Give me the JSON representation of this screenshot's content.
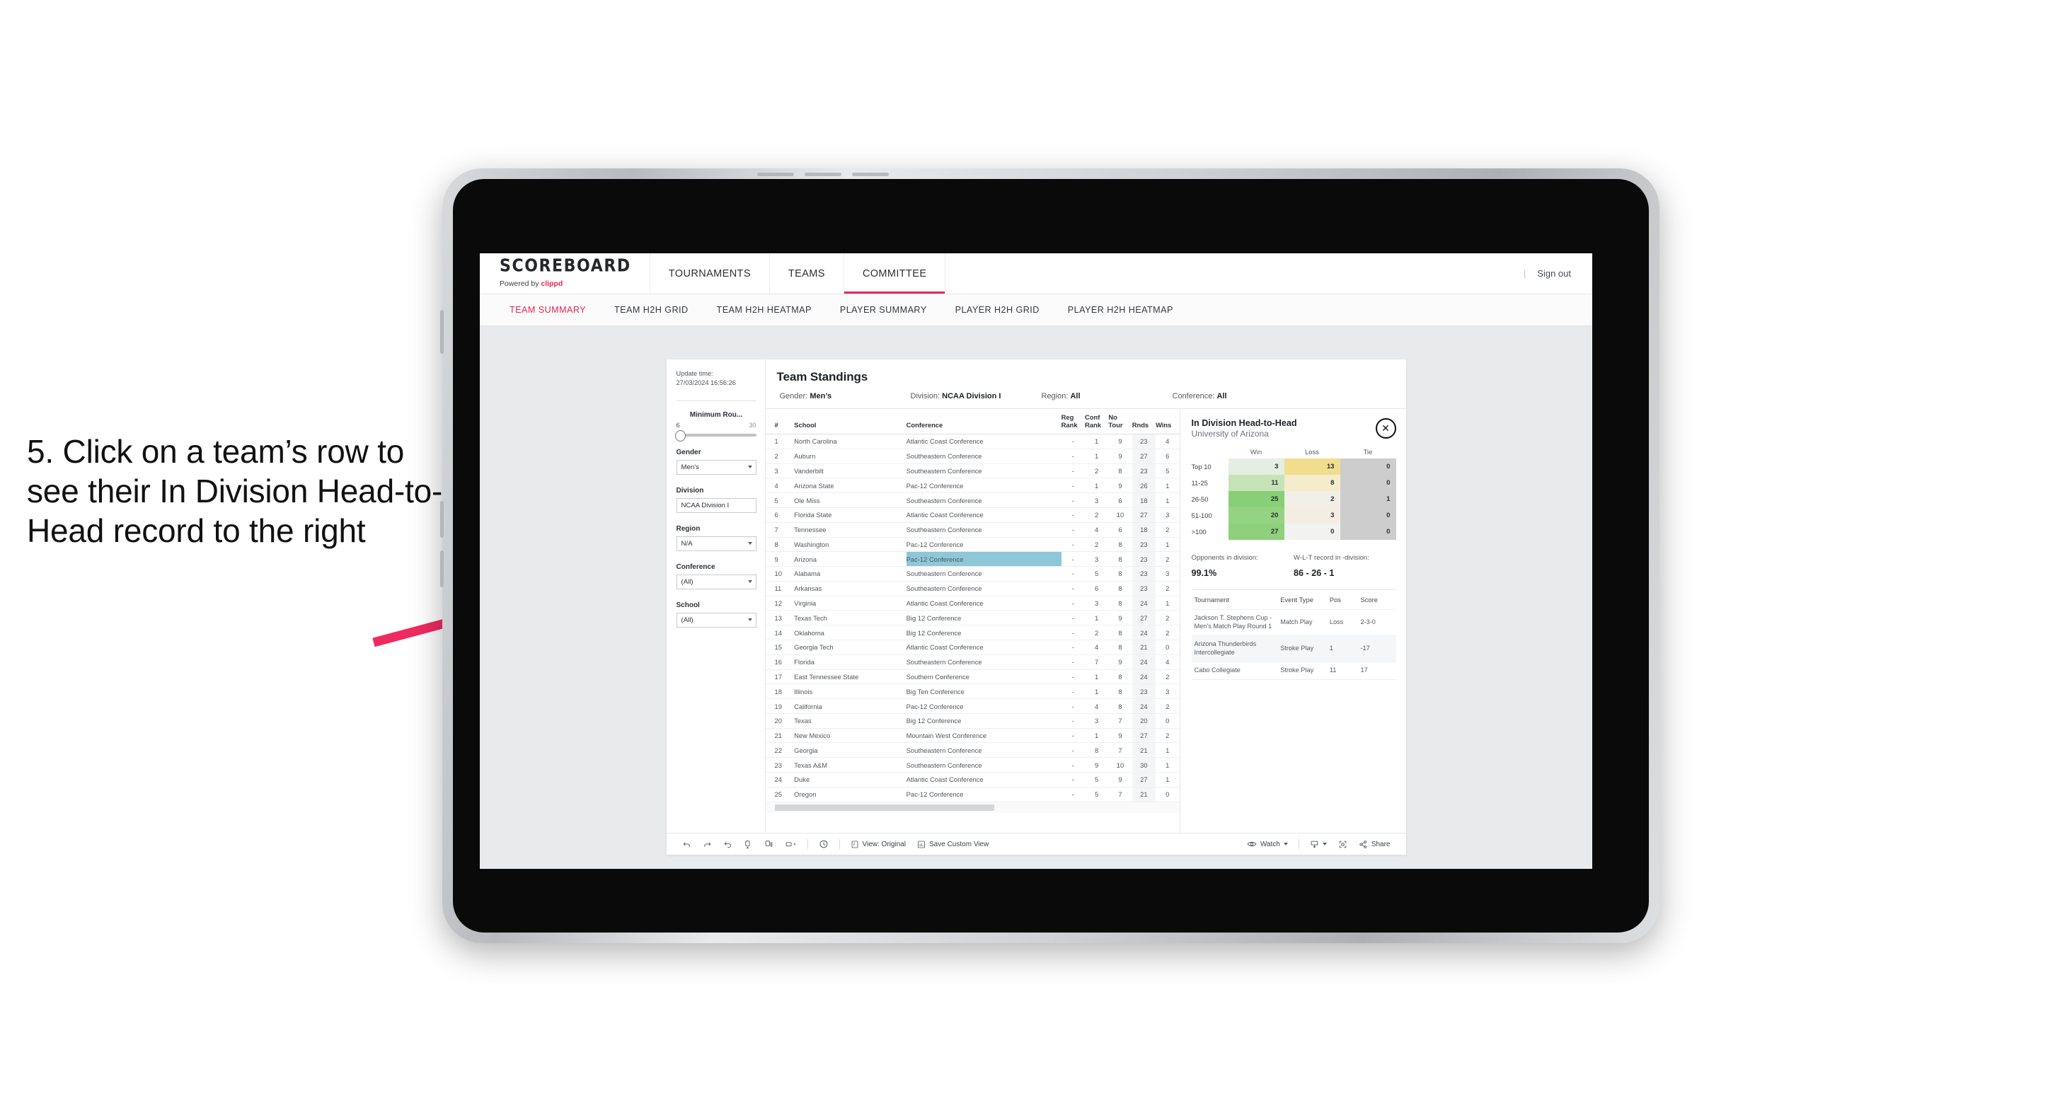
{
  "annotation": {
    "text": "5. Click on a team’s row to see their In Division Head-to-Head record to the right",
    "arrow_color": "#ef2a61"
  },
  "app": {
    "brand": {
      "title": "SCOREBOARD",
      "powered_prefix": "Powered by ",
      "powered_name": "clippd"
    },
    "top_nav": [
      {
        "label": "TOURNAMENTS",
        "active": false
      },
      {
        "label": "TEAMS",
        "active": false
      },
      {
        "label": "COMMITTEE",
        "active": true
      }
    ],
    "top_right": {
      "separator": "|",
      "sign_out": "Sign out"
    },
    "sub_nav": [
      {
        "label": "TEAM SUMMARY",
        "active": true
      },
      {
        "label": "TEAM H2H GRID",
        "active": false
      },
      {
        "label": "TEAM H2H HEATMAP",
        "active": false
      },
      {
        "label": "PLAYER SUMMARY",
        "active": false
      },
      {
        "label": "PLAYER H2H GRID",
        "active": false
      },
      {
        "label": "PLAYER H2H HEATMAP",
        "active": false
      }
    ],
    "accent_color": "#e8264f"
  },
  "filters": {
    "update_time_label": "Update time:",
    "update_time_value": "27/03/2024 16:56:26",
    "slider": {
      "title": "Minimum Rou...",
      "min": "6",
      "max": "30",
      "value": 6
    },
    "groups": [
      {
        "label": "Gender",
        "value": "Men’s"
      },
      {
        "label": "Division",
        "value": "NCAA Division I"
      },
      {
        "label": "Region",
        "value": "N/A"
      },
      {
        "label": "Conference",
        "value": "(All)"
      },
      {
        "label": "School",
        "value": "(All)"
      }
    ]
  },
  "standings": {
    "title": "Team Standings",
    "filter_strip": [
      {
        "key": "Gender: ",
        "value": "Men’s"
      },
      {
        "key": "Division: ",
        "value": "NCAA Division I"
      },
      {
        "key": "Region: ",
        "value": "All"
      },
      {
        "key": "Conference: ",
        "value": "All"
      }
    ],
    "columns": [
      "#",
      "School",
      "Conference",
      "Reg Rank",
      "Conf Rank",
      "No Tour",
      "Rnds",
      "Wins"
    ],
    "rows": [
      {
        "rank": "1",
        "school": "North Carolina",
        "conference": "Atlantic Coast Conference",
        "reg": "-",
        "conf": "1",
        "notour": "9",
        "rnds": "23",
        "wins": "4",
        "selected": false
      },
      {
        "rank": "2",
        "school": "Auburn",
        "conference": "Southeastern Conference",
        "reg": "-",
        "conf": "1",
        "notour": "9",
        "rnds": "27",
        "wins": "6",
        "selected": false
      },
      {
        "rank": "3",
        "school": "Vanderbilt",
        "conference": "Southeastern Conference",
        "reg": "-",
        "conf": "2",
        "notour": "8",
        "rnds": "23",
        "wins": "5",
        "selected": false
      },
      {
        "rank": "4",
        "school": "Arizona State",
        "conference": "Pac-12 Conference",
        "reg": "-",
        "conf": "1",
        "notour": "9",
        "rnds": "26",
        "wins": "1",
        "selected": false
      },
      {
        "rank": "5",
        "school": "Ole Miss",
        "conference": "Southeastern Conference",
        "reg": "-",
        "conf": "3",
        "notour": "6",
        "rnds": "18",
        "wins": "1",
        "selected": false
      },
      {
        "rank": "6",
        "school": "Florida State",
        "conference": "Atlantic Coast Conference",
        "reg": "-",
        "conf": "2",
        "notour": "10",
        "rnds": "27",
        "wins": "3",
        "selected": false
      },
      {
        "rank": "7",
        "school": "Tennessee",
        "conference": "Southeastern Conference",
        "reg": "-",
        "conf": "4",
        "notour": "6",
        "rnds": "18",
        "wins": "2",
        "selected": false
      },
      {
        "rank": "8",
        "school": "Washington",
        "conference": "Pac-12 Conference",
        "reg": "-",
        "conf": "2",
        "notour": "8",
        "rnds": "23",
        "wins": "1",
        "selected": false
      },
      {
        "rank": "9",
        "school": "Arizona",
        "conference": "Pac-12 Conference",
        "reg": "-",
        "conf": "3",
        "notour": "8",
        "rnds": "23",
        "wins": "2",
        "selected": true
      },
      {
        "rank": "10",
        "school": "Alabama",
        "conference": "Southeastern Conference",
        "reg": "-",
        "conf": "5",
        "notour": "8",
        "rnds": "23",
        "wins": "3",
        "selected": false
      },
      {
        "rank": "11",
        "school": "Arkansas",
        "conference": "Southeastern Conference",
        "reg": "-",
        "conf": "6",
        "notour": "8",
        "rnds": "23",
        "wins": "2",
        "selected": false
      },
      {
        "rank": "12",
        "school": "Virginia",
        "conference": "Atlantic Coast Conference",
        "reg": "-",
        "conf": "3",
        "notour": "8",
        "rnds": "24",
        "wins": "1",
        "selected": false
      },
      {
        "rank": "13",
        "school": "Texas Tech",
        "conference": "Big 12 Conference",
        "reg": "-",
        "conf": "1",
        "notour": "9",
        "rnds": "27",
        "wins": "2",
        "selected": false
      },
      {
        "rank": "14",
        "school": "Oklahoma",
        "conference": "Big 12 Conference",
        "reg": "-",
        "conf": "2",
        "notour": "8",
        "rnds": "24",
        "wins": "2",
        "selected": false
      },
      {
        "rank": "15",
        "school": "Georgia Tech",
        "conference": "Atlantic Coast Conference",
        "reg": "-",
        "conf": "4",
        "notour": "8",
        "rnds": "21",
        "wins": "0",
        "selected": false
      },
      {
        "rank": "16",
        "school": "Florida",
        "conference": "Southeastern Conference",
        "reg": "-",
        "conf": "7",
        "notour": "9",
        "rnds": "24",
        "wins": "4",
        "selected": false
      },
      {
        "rank": "17",
        "school": "East Tennessee State",
        "conference": "Southern Conference",
        "reg": "-",
        "conf": "1",
        "notour": "8",
        "rnds": "24",
        "wins": "2",
        "selected": false
      },
      {
        "rank": "18",
        "school": "Illinois",
        "conference": "Big Ten Conference",
        "reg": "-",
        "conf": "1",
        "notour": "8",
        "rnds": "23",
        "wins": "3",
        "selected": false
      },
      {
        "rank": "19",
        "school": "California",
        "conference": "Pac-12 Conference",
        "reg": "-",
        "conf": "4",
        "notour": "8",
        "rnds": "24",
        "wins": "2",
        "selected": false
      },
      {
        "rank": "20",
        "school": "Texas",
        "conference": "Big 12 Conference",
        "reg": "-",
        "conf": "3",
        "notour": "7",
        "rnds": "20",
        "wins": "0",
        "selected": false
      },
      {
        "rank": "21",
        "school": "New Mexico",
        "conference": "Mountain West Conference",
        "reg": "-",
        "conf": "1",
        "notour": "9",
        "rnds": "27",
        "wins": "2",
        "selected": false
      },
      {
        "rank": "22",
        "school": "Georgia",
        "conference": "Southeastern Conference",
        "reg": "-",
        "conf": "8",
        "notour": "7",
        "rnds": "21",
        "wins": "1",
        "selected": false
      },
      {
        "rank": "23",
        "school": "Texas A&M",
        "conference": "Southeastern Conference",
        "reg": "-",
        "conf": "9",
        "notour": "10",
        "rnds": "30",
        "wins": "1",
        "selected": false
      },
      {
        "rank": "24",
        "school": "Duke",
        "conference": "Atlantic Coast Conference",
        "reg": "-",
        "conf": "5",
        "notour": "9",
        "rnds": "27",
        "wins": "1",
        "selected": false
      },
      {
        "rank": "25",
        "school": "Oregon",
        "conference": "Pac-12 Conference",
        "reg": "-",
        "conf": "5",
        "notour": "7",
        "rnds": "21",
        "wins": "0",
        "selected": false
      }
    ]
  },
  "h2h": {
    "title": "In Division Head-to-Head",
    "subtitle": "University of Arizona",
    "close_icon": "close-icon",
    "columns": [
      "Win",
      "Loss",
      "Tie"
    ],
    "rows": [
      {
        "label": "Top 10",
        "win": "3",
        "loss": "13",
        "tie": "0",
        "win_color": "#e4eee2",
        "loss_color": "#f0dd8e",
        "tie_color": "#cdcdcd"
      },
      {
        "label": "11-25",
        "win": "11",
        "loss": "8",
        "tie": "0",
        "win_color": "#c6e3b8",
        "loss_color": "#f5ecc9",
        "tie_color": "#cdcdcd"
      },
      {
        "label": "26-50",
        "win": "25",
        "loss": "2",
        "tie": "1",
        "win_color": "#89cf77",
        "loss_color": "#f1efe7",
        "tie_color": "#cdcdcd"
      },
      {
        "label": "51-100",
        "win": "20",
        "loss": "3",
        "tie": "0",
        "win_color": "#94d382",
        "loss_color": "#f3eee2",
        "tie_color": "#cdcdcd"
      },
      {
        "label": ">100",
        "win": "27",
        "loss": "0",
        "tie": "0",
        "win_color": "#8ed07b",
        "loss_color": "#f2f2f1",
        "tie_color": "#cdcdcd"
      }
    ],
    "stats": [
      {
        "key": "Opponents in division:",
        "value": "99.1%"
      },
      {
        "key": "W-L-T record in -division:",
        "value": "86 - 26 - 1"
      }
    ],
    "events_columns": [
      "Tournament",
      "Event Type",
      "Pos",
      "Score"
    ],
    "events": [
      {
        "tournament": "Jackson T. Stephens Cup - Men’s Match Play Round 1",
        "event_type": "Match Play",
        "pos": "Loss",
        "score": "2-3-0"
      },
      {
        "tournament": "Arizona Thunderbirds Intercollegiate",
        "event_type": "Stroke Play",
        "pos": "1",
        "score": "-17"
      },
      {
        "tournament": "Cabo Collegiate",
        "event_type": "Stroke Play",
        "pos": "11",
        "score": "17"
      }
    ]
  },
  "toolbar": {
    "left_icons": [
      "undo-icon",
      "redo-icon",
      "revert-icon",
      "refresh-data-icon",
      "pause-updates-icon",
      "shape-dropdown-icon"
    ],
    "history_icon": "history-icon",
    "view_label": "View: Original",
    "view_icon": "view-icon",
    "save_view_label": "Save Custom View",
    "save_view_icon": "save-view-icon",
    "watch_label": "Watch",
    "watch_icon": "eye-icon",
    "download_icon": "download-icon",
    "fullscreen_icon": "fullscreen-icon",
    "share_label": "Share",
    "share_icon": "share-icon"
  }
}
